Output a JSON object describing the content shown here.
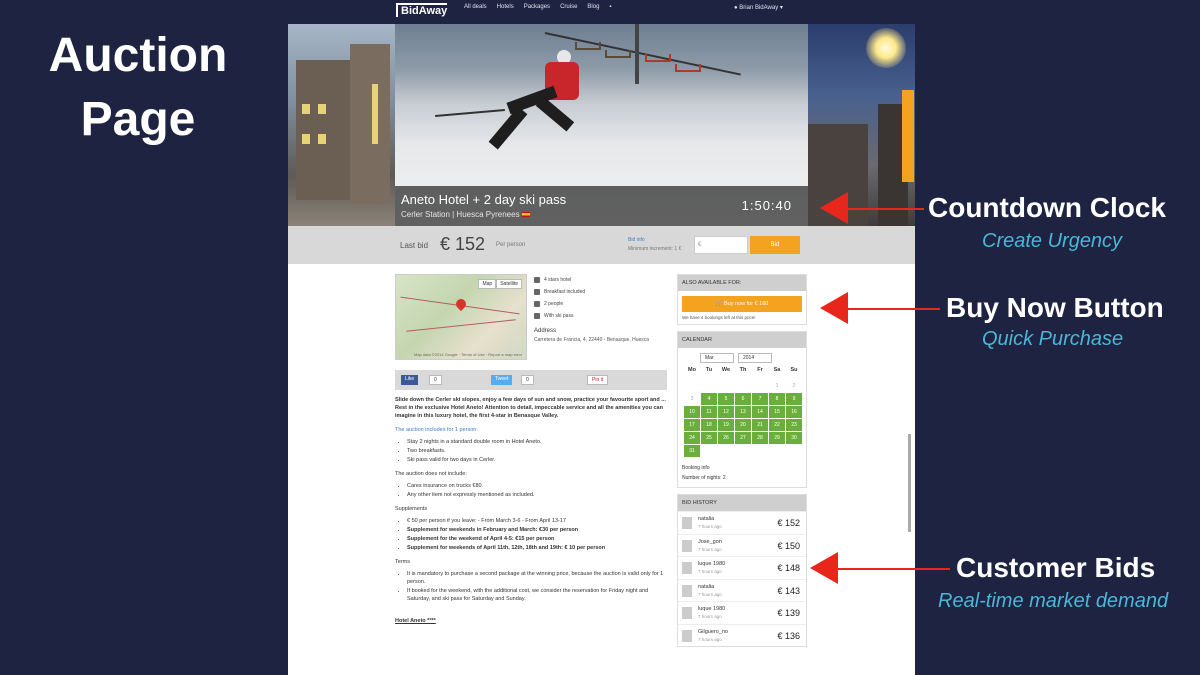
{
  "slide": {
    "title_line1": "Auction",
    "title_line2": "Page"
  },
  "nav": {
    "logo": "BidAway",
    "items": [
      "All deals",
      "Hotels",
      "Packages",
      "Cruise",
      "Blog"
    ],
    "user": "Brian BidAway"
  },
  "hero": {
    "title": "Aneto Hotel + 2 day ski pass",
    "subtitle": "Cerler Station | Huesca Pyrenees",
    "countdown": "1:50:40"
  },
  "bidbar": {
    "last_bid_label": "Last bid",
    "last_bid_value": "€ 152",
    "per_person": "Per person",
    "info_link": "Bid info",
    "info_text": "Minimum increment: 1 €",
    "input_placeholder": "€",
    "bid_button": "Bid"
  },
  "map": {
    "tab_map": "Map",
    "tab_satellite": "Satellite",
    "footer": "Map data ©2014 Google · Terms of Use · Report a map error"
  },
  "features": [
    "4 stars hotel",
    "Breakfast included",
    "2 people",
    "With ski pass"
  ],
  "address": {
    "label": "Address",
    "text": "Carretera de Francia, 4, 22440 - Benasque, Huesca"
  },
  "social": {
    "like": "Like",
    "like_count": "0",
    "tweet": "Tweet",
    "tweet_count": "0",
    "pin": "Pin it"
  },
  "description": {
    "intro": "Slide down the Cerler ski slopes, enjoy a few days of sun and snow, practice your favourite sport and ... Rest in the exclusive Hotel Aneto! Attention to detail, impeccable service and all the amenities you can imagine in this luxury hotel, the first 4-star in Benasque Valley.",
    "includes_h": "The auction includes for 1 person:",
    "includes": [
      "Stay 2 nights in a standard double room in Hotel Aneto.",
      "Two breakfasts.",
      "Ski pass valid for two days in Cerler."
    ],
    "excludes_h": "The auction does not include:",
    "excludes": [
      "Cares insurance on trucks €80.",
      "Any other item not expressly mentioned as included."
    ],
    "supplements_h": "Supplements",
    "supplements": [
      "€ 50 per person if you leave: - From March 3-6 - From April 13-17",
      "Supplement for weekends in February and March: €30 per person",
      "Supplement for the weekend of April 4-5: €15 per person",
      "Supplement for weekends of April 11th, 12th, 18th and 19th: € 10 per person"
    ],
    "terms_h": "Terms",
    "terms": [
      "It is mandatory to purchase a second package at the winning price, because the auction is valid only for 1 person.",
      "If booked for the weekend, with the additional cost, we consider the reservation for Friday night and Saturday, and ski pass for Saturday and Sunday."
    ],
    "hotel_h": "Hotel Aneto ****"
  },
  "sidebar": {
    "also_h": "ALSO AVAILABLE FOR:",
    "buy_now": "Buy now for € 160",
    "buy_note": "We have 4 bookings left at this price!",
    "calendar_h": "CALENDAR",
    "cal_month": "Mar",
    "cal_year": "2014",
    "dow": [
      "Mo",
      "Tu",
      "We",
      "Th",
      "Fr",
      "Sa",
      "Su"
    ],
    "days": [
      [
        "",
        "",
        "",
        "",
        "",
        "1",
        "2"
      ],
      [
        "3",
        "4",
        "5",
        "6",
        "7",
        "8",
        "9"
      ],
      [
        "10",
        "11",
        "12",
        "13",
        "14",
        "15",
        "16"
      ],
      [
        "17",
        "18",
        "19",
        "20",
        "21",
        "22",
        "23"
      ],
      [
        "24",
        "25",
        "26",
        "27",
        "28",
        "29",
        "30"
      ],
      [
        "31",
        "",
        "",
        "",
        "",
        "",
        ""
      ]
    ],
    "booking_info": "Booking info",
    "nights": "Number of nights: 2",
    "history_h": "BID HISTORY",
    "bids": [
      {
        "user": "natalia",
        "time": "7 hours ago",
        "amount": "€ 152"
      },
      {
        "user": "Jose_gon",
        "time": "7 hours ago",
        "amount": "€ 150"
      },
      {
        "user": "luque 1980",
        "time": "7 hours ago",
        "amount": "€ 148"
      },
      {
        "user": "natalia",
        "time": "7 hours ago",
        "amount": "€ 143"
      },
      {
        "user": "luque 1980",
        "time": "7 hours ago",
        "amount": "€ 139"
      },
      {
        "user": "Gilguero_no",
        "time": "7 hours ago",
        "amount": "€ 136"
      }
    ]
  },
  "annotations": [
    {
      "title": "Countdown Clock",
      "subtitle": "Create Urgency"
    },
    {
      "title": "Buy Now Button",
      "subtitle": "Quick Purchase"
    },
    {
      "title": "Customer Bids",
      "subtitle": "Real-time market demand"
    }
  ],
  "colors": {
    "background": "#1d2340",
    "accent": "#f4a321",
    "arrow": "#e8261c",
    "subtitle": "#4ab7d8",
    "calendar_available": "#6aaf3c"
  }
}
